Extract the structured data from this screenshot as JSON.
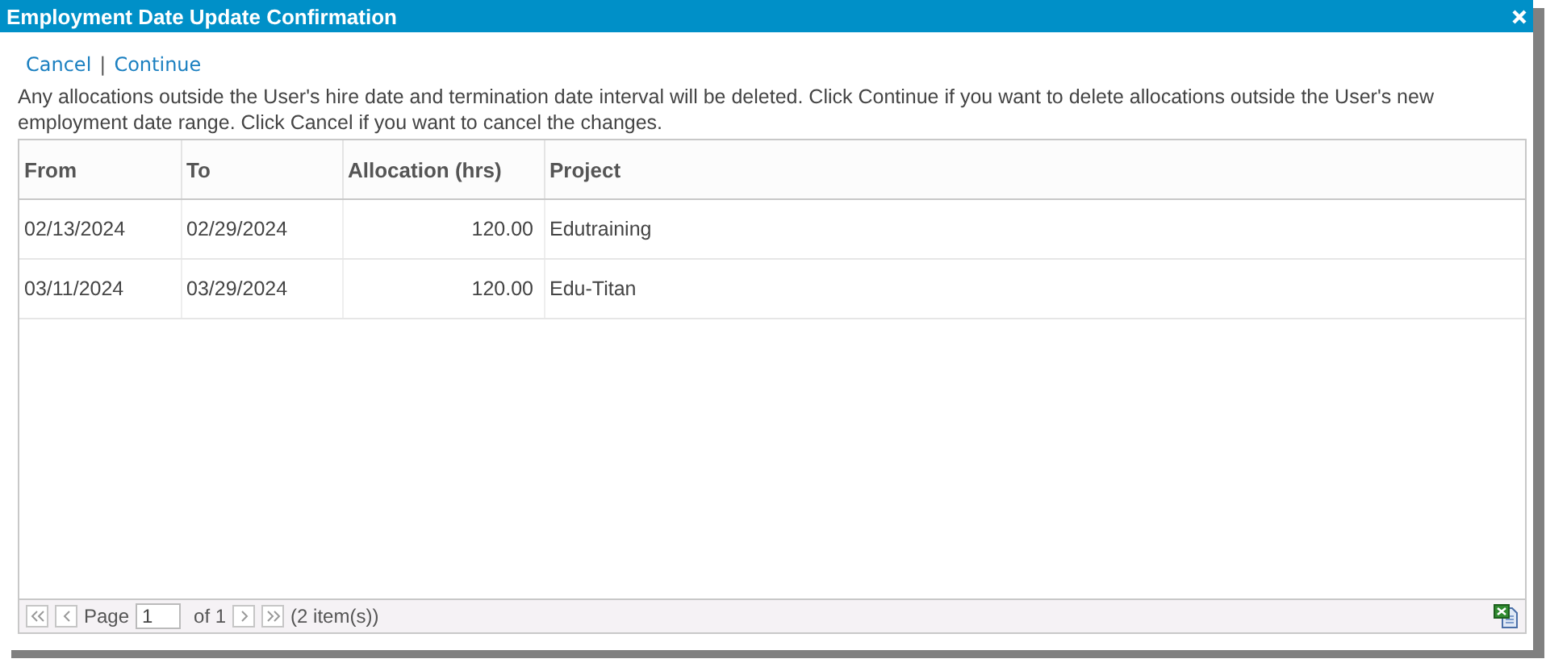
{
  "window": {
    "title": "Employment Date Update Confirmation"
  },
  "actions": [
    {
      "label": "Cancel"
    },
    {
      "label": "Continue"
    }
  ],
  "action_separator": "|",
  "message": "Any allocations outside the User's hire date and termination date interval will be deleted. Click Continue if you want to delete allocations outside the User's new employment date range. Click Cancel if you want to cancel the changes.",
  "table": {
    "columns": [
      {
        "label": "From",
        "kind": "text"
      },
      {
        "label": "To",
        "kind": "text"
      },
      {
        "label": "Allocation (hrs)",
        "kind": "number"
      },
      {
        "label": "Project",
        "kind": "text"
      }
    ],
    "rows": [
      [
        "02/13/2024",
        "02/29/2024",
        "120.00",
        "Edutraining"
      ],
      [
        "03/11/2024",
        "03/29/2024",
        "120.00",
        "Edu-Titan"
      ]
    ]
  },
  "pager": {
    "page_label": "Page",
    "page_value": "1",
    "of_label": "of 1",
    "item_count": "(2 item(s))"
  }
}
